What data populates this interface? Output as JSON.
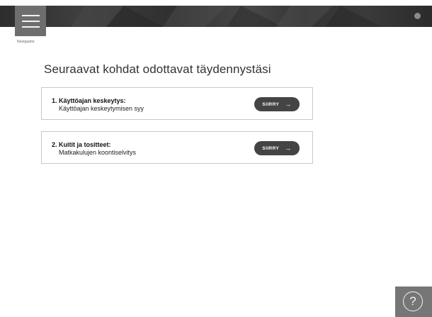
{
  "header": {
    "menu_icon": "hamburger-icon",
    "nav_label": "Navigaatio"
  },
  "main": {
    "heading": "Seuraavat kohdat odottavat täydennystäsi",
    "tasks": [
      {
        "title": "1. Käyttöajan keskeytys:",
        "subtitle": "Käyttöajan keskeytymisen syy",
        "button_label": "SIIRRY",
        "button_icon": "arrow-right-icon"
      },
      {
        "title": "2. Kuitit ja tositteet:",
        "subtitle": "Matkakulujen koontiselvitys",
        "button_label": "SIIRRY",
        "button_icon": "arrow-right-icon"
      }
    ]
  },
  "help": {
    "icon": "help-icon",
    "symbol": "?"
  },
  "colors": {
    "topbar": "#333333",
    "menu_button": "#6e6e6e",
    "go_button": "#444444",
    "help_button": "#767676"
  }
}
